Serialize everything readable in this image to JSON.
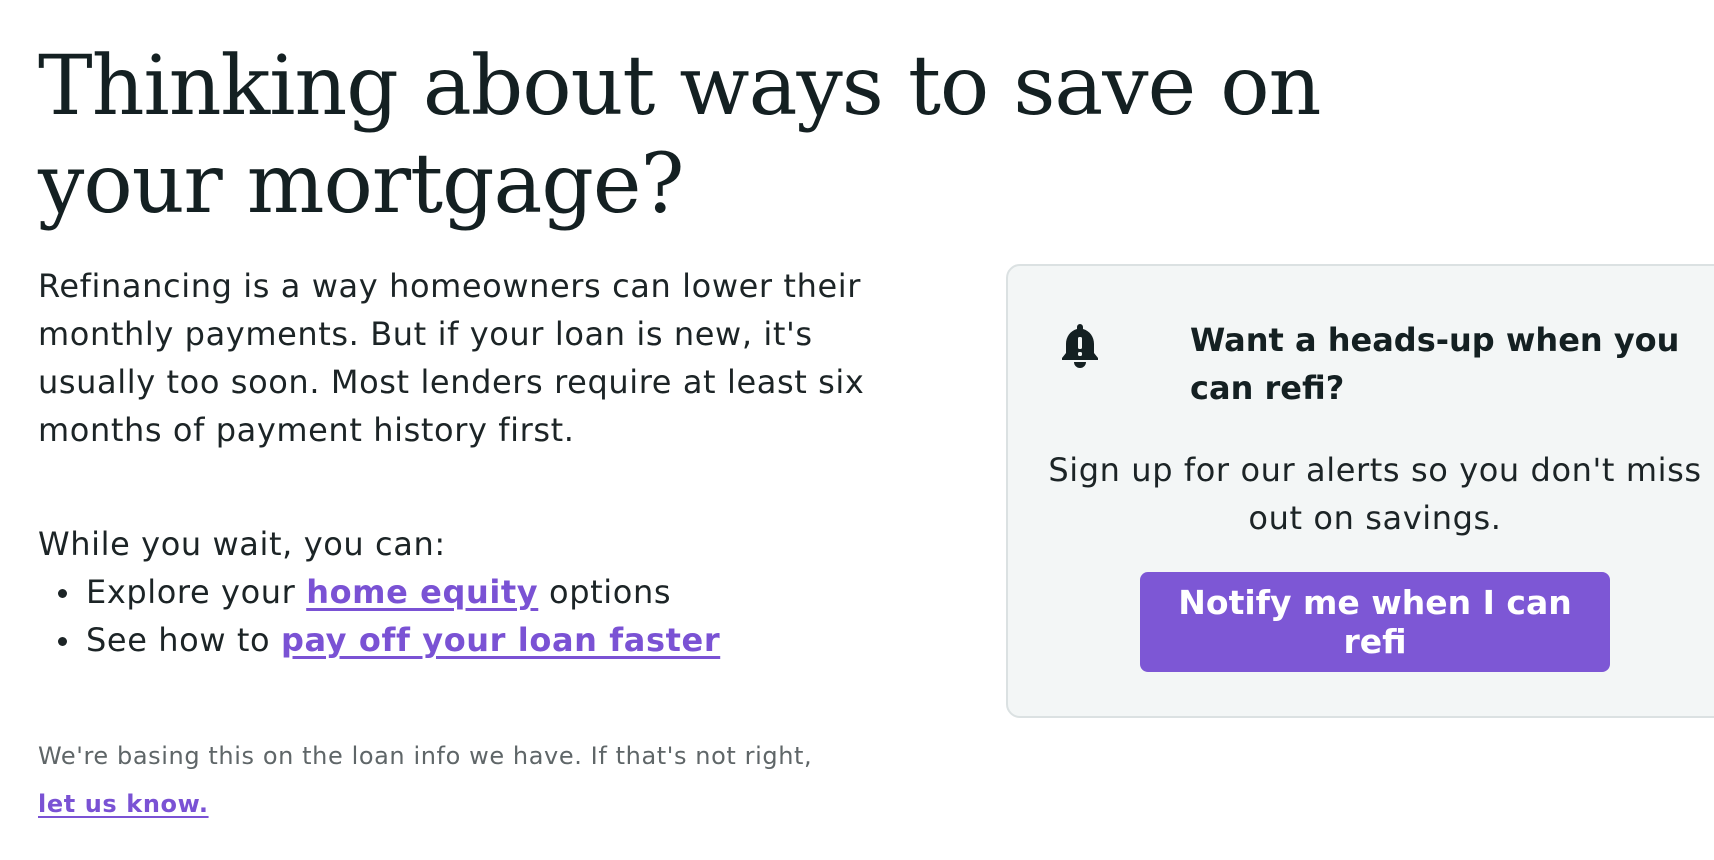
{
  "headline": "Thinking about ways to save on your mortgage?",
  "intro": "Refinancing is a way homeowners can lower their monthly payments. But if your loan is new, it's usually too soon. Most lenders require at least six months of payment history first.",
  "wait_label": "While you wait, you can:",
  "tips": [
    {
      "prefix": "Explore your ",
      "link": "home equity",
      "suffix": " options"
    },
    {
      "prefix": "See how to ",
      "link": "pay off your loan faster",
      "suffix": ""
    }
  ],
  "footnote": {
    "text": "We're basing this on the loan info we have. If that's not right,",
    "link": "let us know."
  },
  "alert_card": {
    "icon": "bell-icon",
    "title": "Want a heads-up when you can refi?",
    "body": "Sign up for our alerts so you don't miss out on savings.",
    "button_label": "Notify me when I can refi"
  },
  "colors": {
    "link": "#7a52d4",
    "button": "#7d57d5",
    "card_background": "#f3f6f6",
    "text": "#1c2426"
  }
}
